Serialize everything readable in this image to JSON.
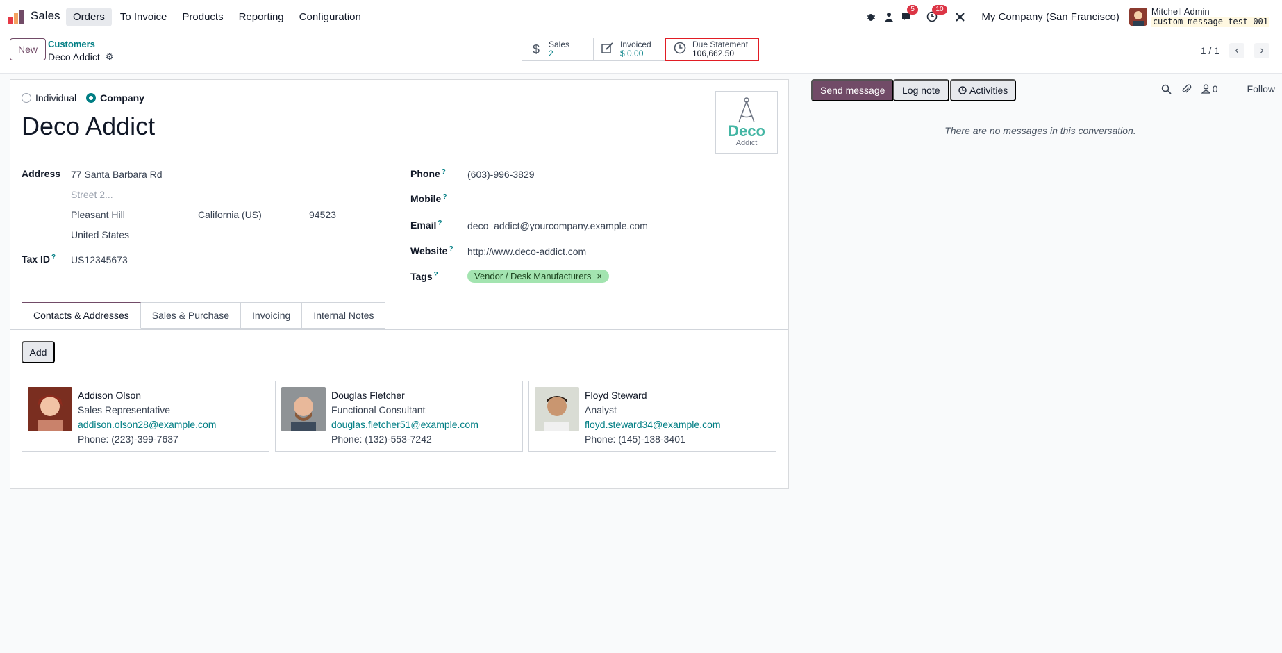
{
  "app": {
    "name": "Sales"
  },
  "menu": {
    "items": [
      {
        "label": "Orders",
        "active": true
      },
      {
        "label": "To Invoice",
        "active": false
      },
      {
        "label": "Products",
        "active": false
      },
      {
        "label": "Reporting",
        "active": false
      },
      {
        "label": "Configuration",
        "active": false
      }
    ]
  },
  "systray": {
    "messages_count": "5",
    "activities_count": "10",
    "company": "My Company (San Francisco)",
    "user_name": "Mitchell Admin",
    "database": "custom_message_test_001"
  },
  "control": {
    "new_label": "New",
    "breadcrumb_parent": "Customers",
    "breadcrumb_current": "Deco Addict",
    "pager": "1 / 1"
  },
  "smart_buttons": {
    "sales": {
      "title": "Sales",
      "value": "2"
    },
    "invoiced": {
      "title": "Invoiced",
      "value": "$ 0.00"
    },
    "due": {
      "title": "Due Statement",
      "value": "106,662.50"
    }
  },
  "form": {
    "type_individual": "Individual",
    "type_company": "Company",
    "name": "Deco Addict",
    "logo_word": "Deco",
    "logo_sub": "Addict",
    "address_label": "Address",
    "street": "77 Santa Barbara Rd",
    "street2_placeholder": "Street 2...",
    "city": "Pleasant Hill",
    "state": "California (US)",
    "zip": "94523",
    "country": "United States",
    "tax_label": "Tax ID",
    "tax_value": "US12345673",
    "phone_label": "Phone",
    "phone_value": "(603)-996-3829",
    "mobile_label": "Mobile",
    "email_label": "Email",
    "email_value": "deco_addict@yourcompany.example.com",
    "website_label": "Website",
    "website_value": "http://www.deco-addict.com",
    "tags_label": "Tags",
    "tag_value": "Vendor / Desk Manufacturers"
  },
  "tabs": {
    "contacts": "Contacts & Addresses",
    "sales_purchase": "Sales & Purchase",
    "invoicing": "Invoicing",
    "notes": "Internal Notes"
  },
  "add_label": "Add",
  "contacts": [
    {
      "name": "Addison Olson",
      "role": "Sales Representative",
      "email": "addison.olson28@example.com",
      "phone": "Phone: (223)-399-7637"
    },
    {
      "name": "Douglas Fletcher",
      "role": "Functional Consultant",
      "email": "douglas.fletcher51@example.com",
      "phone": "Phone: (132)-553-7242"
    },
    {
      "name": "Floyd Steward",
      "role": "Analyst",
      "email": "floyd.steward34@example.com",
      "phone": "Phone: (145)-138-3401"
    }
  ],
  "chatter": {
    "send_label": "Send message",
    "log_label": "Log note",
    "activities_label": "Activities",
    "followers_count": "0",
    "follow_label": "Follow",
    "empty_text": "There are no messages in this conversation."
  }
}
